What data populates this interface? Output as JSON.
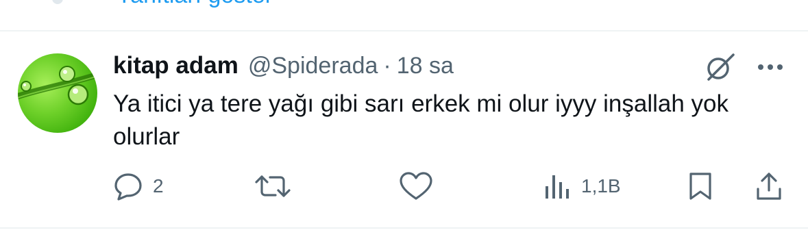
{
  "previous_reply": {
    "show_replies_label": "Yanıtları göster"
  },
  "tweet": {
    "display_name": "kitap adam",
    "handle": "@Spiderada",
    "separator": "·",
    "time": "18 sa",
    "text": "Ya itici ya tere yağı gibi sarı erkek mi olur iyyy inşallah yok olurlar",
    "actions": {
      "reply_count": "2",
      "retweet_count": "",
      "like_count": "",
      "views_count": "1,1B"
    }
  },
  "colors": {
    "text_primary": "#0f1419",
    "text_secondary": "#536471",
    "link": "#1d9bf0",
    "avatar_green": "#6fd12a"
  },
  "icons": [
    "reply-icon",
    "retweet-icon",
    "like-icon",
    "views-icon",
    "bookmark-icon",
    "share-icon",
    "grok-icon",
    "more-icon"
  ]
}
